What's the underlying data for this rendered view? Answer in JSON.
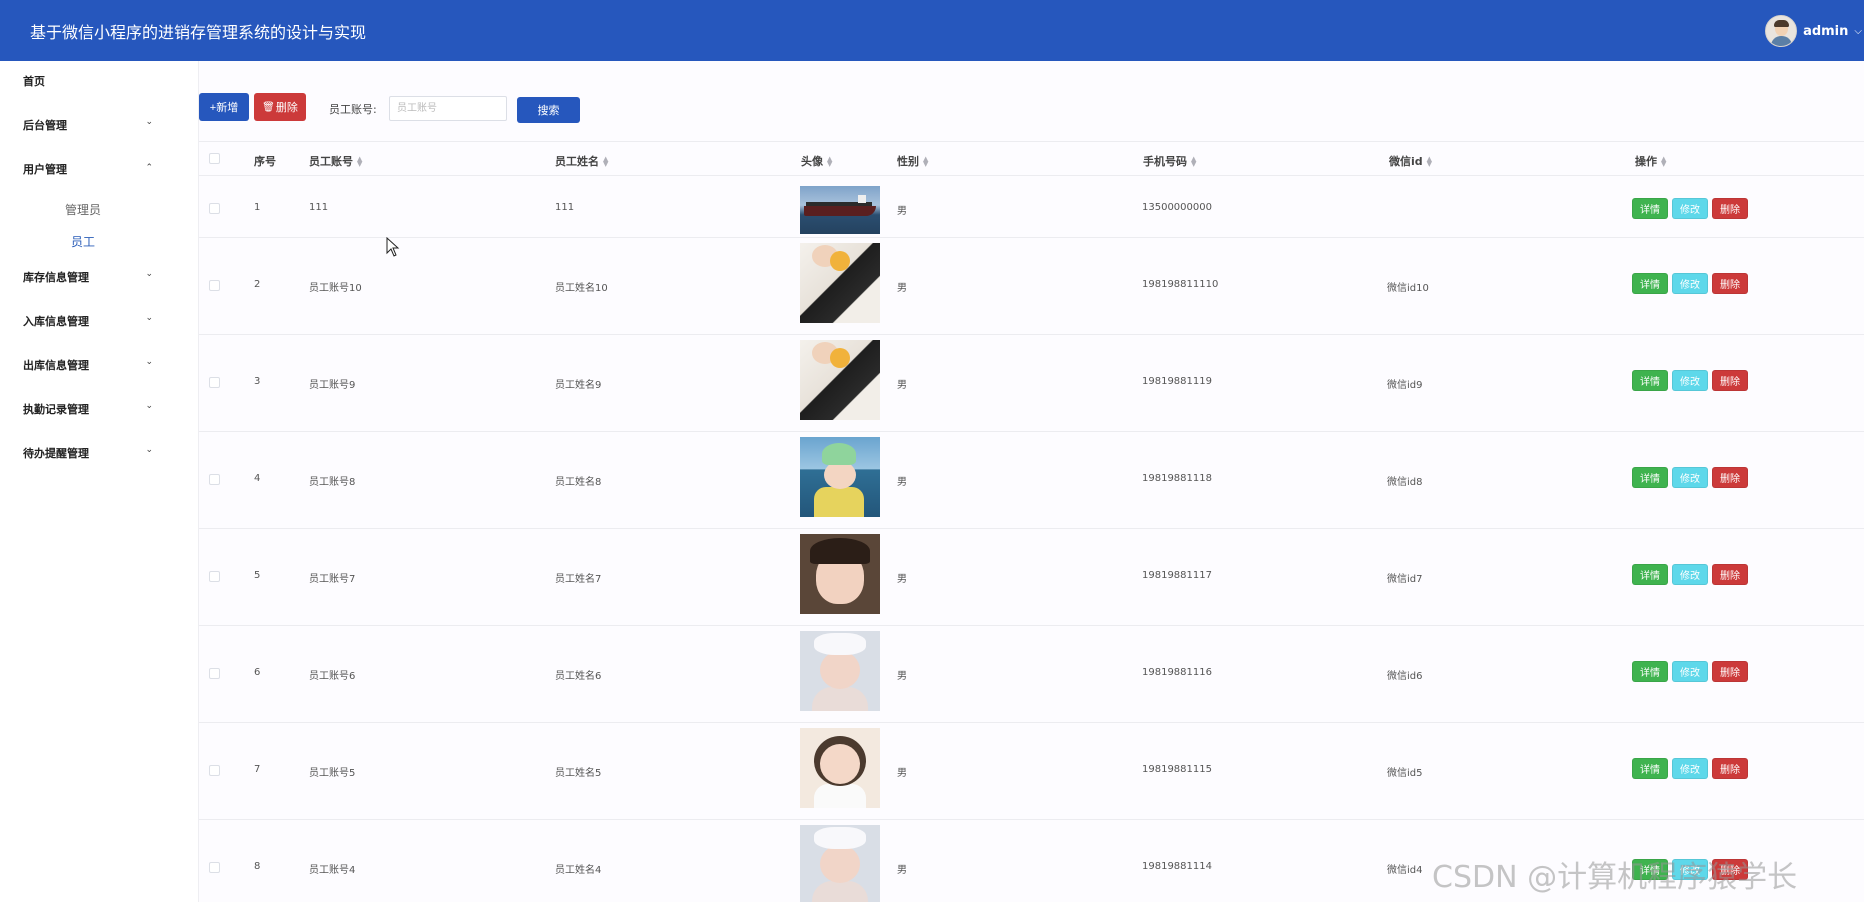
{
  "header": {
    "title": "基于微信小程序的进销存管理系统的设计与实现",
    "username": "admin",
    "caret_icon": "chevron-down-icon"
  },
  "sidebar": {
    "items": [
      {
        "label": "首页",
        "expanded": null
      },
      {
        "label": "后台管理",
        "expanded": false
      },
      {
        "label": "用户管理",
        "expanded": true
      },
      {
        "label": "库存信息管理",
        "expanded": false
      },
      {
        "label": "入库信息管理",
        "expanded": false
      },
      {
        "label": "出库信息管理",
        "expanded": false
      },
      {
        "label": "执勤记录管理",
        "expanded": false
      },
      {
        "label": "待办提醒管理",
        "expanded": false
      }
    ],
    "user_sub_items": [
      {
        "label": "管理员",
        "active": false
      },
      {
        "label": "员工",
        "active": true
      }
    ]
  },
  "toolbar": {
    "add_label": "+新增",
    "delete_label": "删除",
    "search_label": "员工账号:",
    "search_placeholder": "员工账号",
    "search_value": "",
    "search_button": "搜索"
  },
  "table": {
    "columns": [
      "序号",
      "员工账号",
      "员工姓名",
      "头像",
      "性别",
      "手机号码",
      "微信id",
      "操作"
    ],
    "rows": [
      {
        "index": "1",
        "account": "111",
        "name": "111",
        "photo": "ship",
        "gender": "男",
        "phone": "13500000000",
        "wechat": ""
      },
      {
        "index": "2",
        "account": "员工账号10",
        "name": "员工姓名10",
        "photo": "girl-flower",
        "gender": "男",
        "phone": "198198811110",
        "wechat": "微信id10"
      },
      {
        "index": "3",
        "account": "员工账号9",
        "name": "员工姓名9",
        "photo": "girl-flower",
        "gender": "男",
        "phone": "19819881119",
        "wechat": "微信id9"
      },
      {
        "index": "4",
        "account": "员工账号8",
        "name": "员工姓名8",
        "photo": "girl-sea",
        "gender": "男",
        "phone": "19819881118",
        "wechat": "微信id8"
      },
      {
        "index": "5",
        "account": "员工账号7",
        "name": "员工姓名7",
        "photo": "girl-portrait",
        "gender": "男",
        "phone": "19819881117",
        "wechat": "微信id7"
      },
      {
        "index": "6",
        "account": "员工账号6",
        "name": "员工姓名6",
        "photo": "girl-bow",
        "gender": "男",
        "phone": "19819881116",
        "wechat": "微信id6"
      },
      {
        "index": "7",
        "account": "员工账号5",
        "name": "员工姓名5",
        "photo": "girl-white",
        "gender": "男",
        "phone": "19819881115",
        "wechat": "微信id5"
      },
      {
        "index": "8",
        "account": "员工账号4",
        "name": "员工姓名4",
        "photo": "girl-bow",
        "gender": "男",
        "phone": "19819881114",
        "wechat": "微信id4"
      }
    ],
    "actions": {
      "detail": "详情",
      "edit": "修改",
      "delete": "删除"
    }
  },
  "watermark": "CSDN @计算机程序猿学长",
  "colors": {
    "header_bg": "#2657bd",
    "primary": "#2657bd",
    "danger": "#cc3a3a",
    "success": "#3fb34f",
    "info": "#5ed8ea",
    "active_menu": "#2a5db8"
  }
}
